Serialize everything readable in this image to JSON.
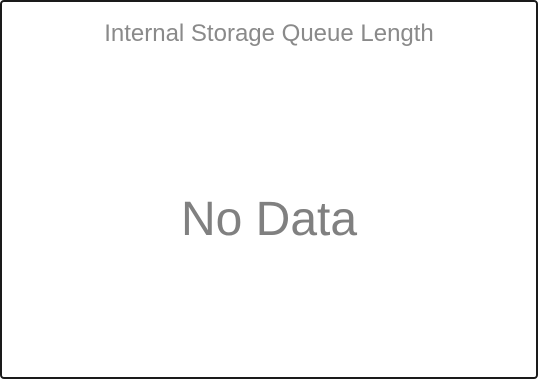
{
  "panel": {
    "title": "Internal Storage Queue Length",
    "empty_message": "No Data"
  },
  "colors": {
    "border": "#1a1a1a",
    "title_text": "#8a8a8a",
    "message_text": "#808080",
    "background": "#ffffff"
  }
}
